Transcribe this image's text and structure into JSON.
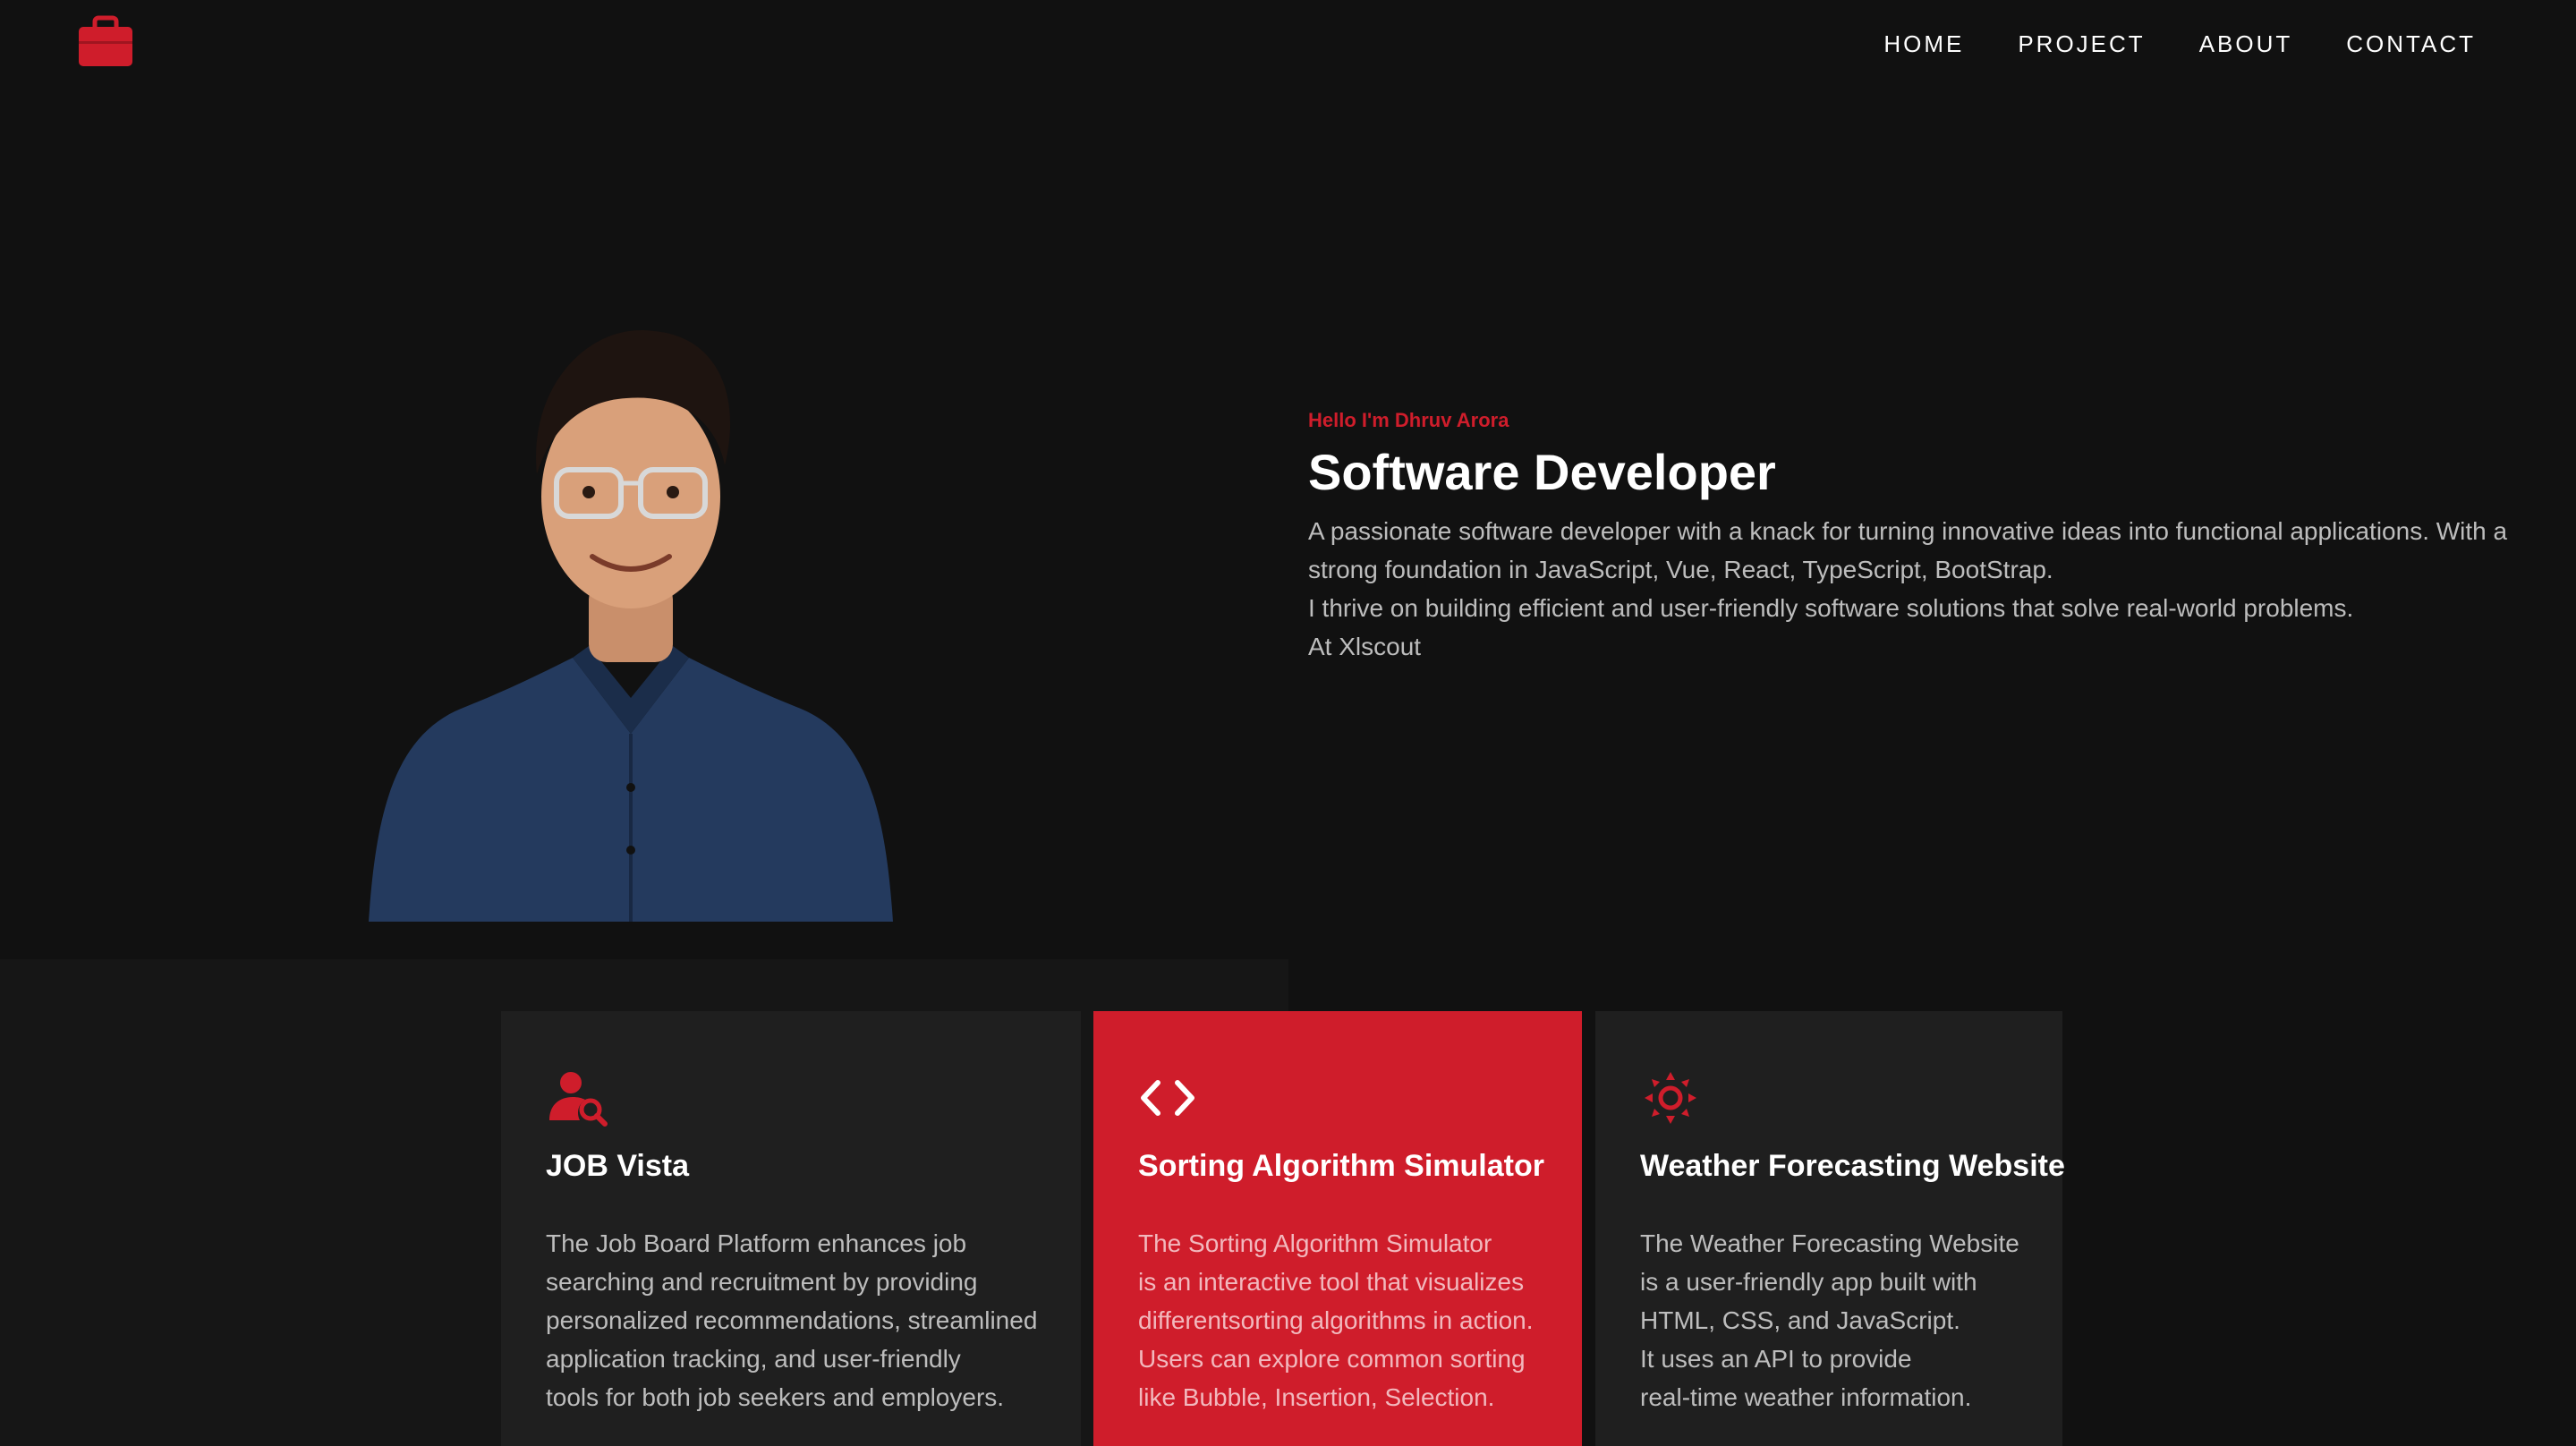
{
  "header": {
    "logo_icon": "briefcase-icon",
    "nav": [
      {
        "label": "HOME"
      },
      {
        "label": "PROJECT"
      },
      {
        "label": "ABOUT"
      },
      {
        "label": "CONTACT"
      }
    ]
  },
  "hero": {
    "greeting": "Hello I'm Dhruv Arora",
    "role": "Software Developer",
    "description_lines": [
      "A passionate software developer with a knack for turning innovative ideas into functional applications. With a",
      "strong foundation in JavaScript, Vue, React, TypeScript, BootStrap.",
      "I thrive on building efficient and user-friendly software solutions that solve real-world problems.",
      "At Xlscout"
    ]
  },
  "projects": [
    {
      "icon": "user-search-icon",
      "title": "JOB Vista",
      "lines": [
        "The Job Board Platform enhances job",
        "searching and recruitment by providing",
        "personalized recommendations, streamlined",
        "application tracking, and user-friendly",
        "tools for both job seekers and employers."
      ]
    },
    {
      "icon": "code-icon",
      "title": "Sorting Algorithm Simulator",
      "lines": [
        "The Sorting Algorithm Simulator",
        "is an interactive tool that visualizes",
        "differentsorting algorithms in action.",
        "Users can explore common sorting",
        "like Bubble, Insertion, Selection."
      ]
    },
    {
      "icon": "sun-icon",
      "title": "Weather Forecasting Website",
      "lines": [
        "The Weather Forecasting Website",
        "is a user-friendly app built with",
        "HTML, CSS, and JavaScript.",
        "It uses an API to provide",
        "real-time weather information."
      ]
    }
  ],
  "colors": {
    "accent": "#cf1d2b",
    "background": "#111111",
    "card": "#1f1f1f",
    "body_text": "#bdbdbd"
  }
}
